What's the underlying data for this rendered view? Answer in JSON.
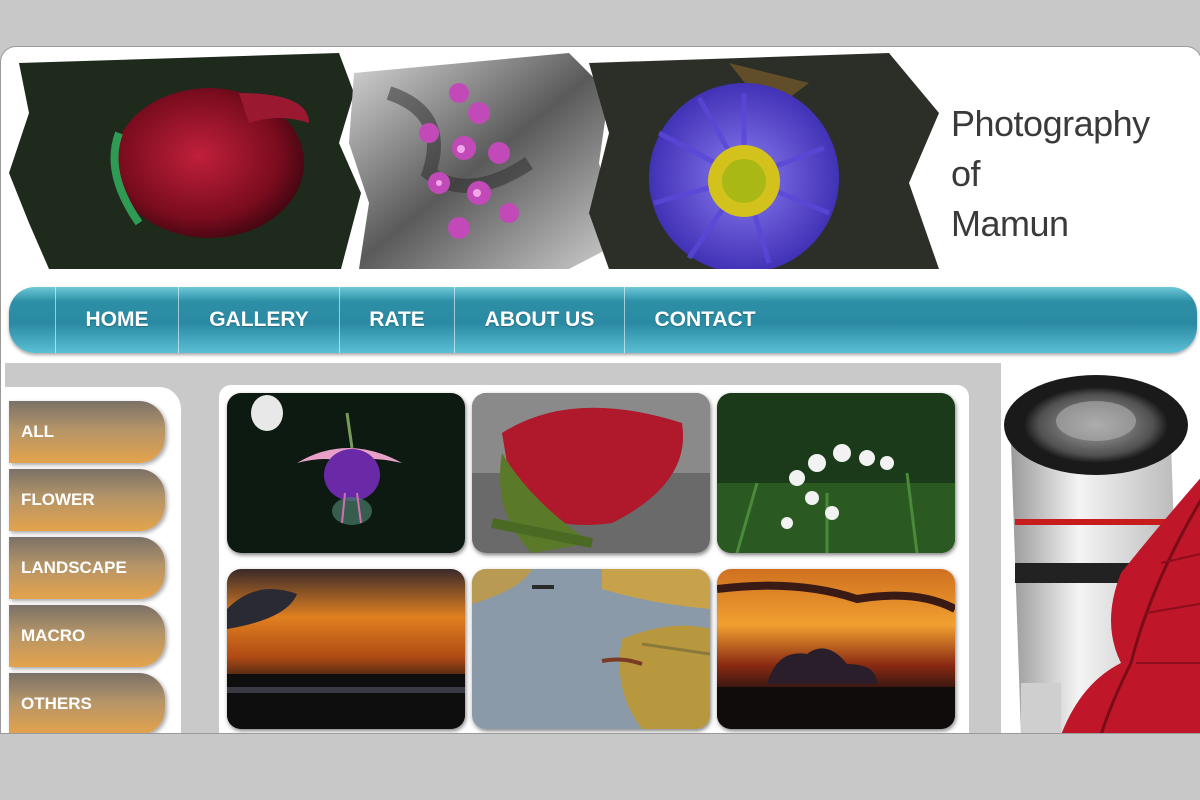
{
  "site": {
    "title_lines": [
      "Photography",
      "of",
      "Mamun"
    ]
  },
  "nav": {
    "items": [
      "HOME",
      "GALLERY",
      "RATE",
      "ABOUT US",
      "CONTACT"
    ]
  },
  "sidebar": {
    "categories": [
      "ALL",
      "FLOWER",
      "LANDSCAPE",
      "MACRO",
      "OTHERS"
    ]
  },
  "gallery": {
    "photos": [
      {
        "icon": "fuchsia-flower-photo"
      },
      {
        "icon": "red-rosebud-photo"
      },
      {
        "icon": "white-wildflower-photo"
      },
      {
        "icon": "orange-sunset-photo"
      },
      {
        "icon": "river-marsh-photo"
      },
      {
        "icon": "sunset-cloud-photo"
      }
    ]
  },
  "banner": {
    "icons": [
      "red-rose-image",
      "pink-flower-image",
      "purple-aster-image"
    ]
  },
  "decoration": {
    "icons": [
      "camera-lens-image",
      "red-leaf-image"
    ]
  },
  "colors": {
    "nav_teal": "#2a8aa3",
    "button_orange": "#e4a34c",
    "background_gray": "#c9c9c9"
  }
}
